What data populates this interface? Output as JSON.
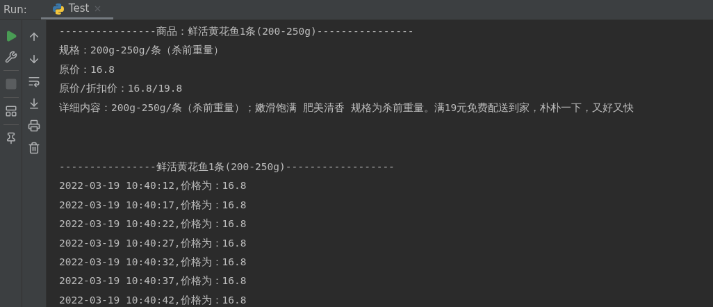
{
  "run_label": "Run:",
  "tab": {
    "label": "Test",
    "selected": true
  },
  "left_tools": [
    {
      "kind": "run",
      "disabled": false
    },
    {
      "kind": "wrench",
      "disabled": false
    },
    {
      "kind": "stop",
      "disabled": true
    },
    {
      "kind": "layout",
      "disabled": false
    },
    {
      "kind": "pin",
      "disabled": false
    }
  ],
  "right_tools": [
    {
      "kind": "up"
    },
    {
      "kind": "down"
    },
    {
      "kind": "wrap"
    },
    {
      "kind": "scroll-end"
    },
    {
      "kind": "print"
    },
    {
      "kind": "trash"
    }
  ],
  "console": [
    {
      "lines": [
        "----------------商品：鲜活黄花鱼1条(200-250g)----------------",
        "规格：200g-250g/条（杀前重量）",
        "原价：16.8",
        "原价/折扣价：16.8/19.8",
        "详细内容：200g-250g/条（杀前重量）；嫩滑饱满 肥美清香 规格为杀前重量。满19元免费配送到家，朴朴一下，又好又快"
      ]
    },
    {
      "lines": [
        "----------------鲜活黄花鱼1条(200-250g)------------------",
        "2022-03-19 10:40:12,价格为：16.8",
        "2022-03-19 10:40:17,价格为：16.8",
        "2022-03-19 10:40:22,价格为：16.8",
        "2022-03-19 10:40:27,价格为：16.8",
        "2022-03-19 10:40:32,价格为：16.8",
        "2022-03-19 10:40:37,价格为：16.8",
        "2022-03-19 10:40:42,价格为：16.8"
      ]
    }
  ]
}
